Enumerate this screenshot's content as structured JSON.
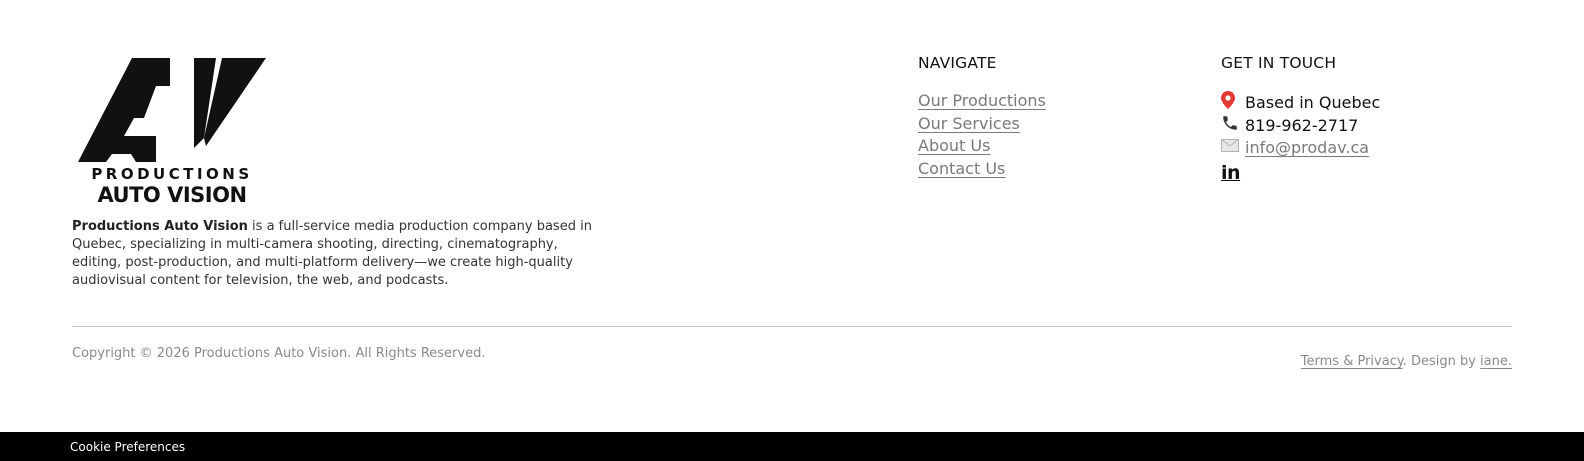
{
  "brand": {
    "logo_line1": "PRODUCTIONS",
    "logo_line2": "AUTO VISION",
    "name": "Productions Auto Vision",
    "description": " is a full-service media production company based in Quebec, specializing in multi-camera shooting, directing, cinematography, editing, post-production, and multi-platform delivery—we create high-quality audiovisual content for television, the web, and podcasts."
  },
  "navigate": {
    "title": "NAVIGATE",
    "links": [
      "Our Productions",
      "Our Services",
      "About Us",
      "Contact Us"
    ]
  },
  "contact": {
    "title": "GET IN TOUCH",
    "location_icon": "location-pin-icon",
    "location": "Based in Quebec",
    "phone_icon": "phone-icon",
    "phone": "819-962-2717",
    "email_icon": "envelope-icon",
    "email": "info@prodav.ca",
    "social_icon": "linkedin-icon",
    "linkedin_glyph": "in"
  },
  "footer": {
    "copyright": "Copyright © 2026 Productions Auto Vision. All Rights Reserved.",
    "terms": "Terms & Privacy",
    "design_by": ". Design by ",
    "designer": "iane."
  },
  "cookie": {
    "label": "Cookie Preferences"
  },
  "colors": {
    "text": "#111111",
    "link": "#7a7a7a",
    "muted": "#8a8a8a",
    "bar": "#000000",
    "pin": "#e53935"
  }
}
